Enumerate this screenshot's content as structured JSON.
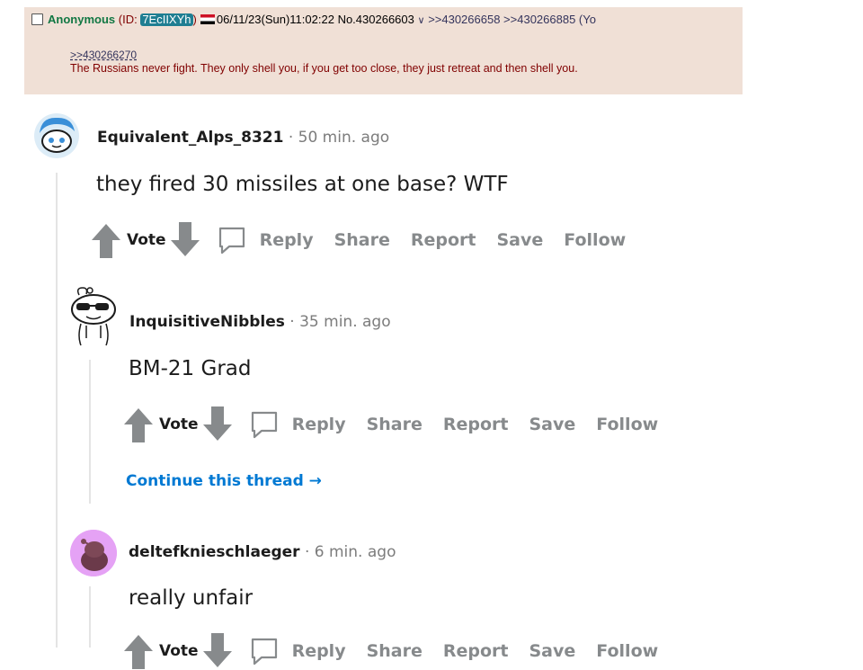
{
  "chan_post": {
    "name": "Anonymous",
    "id_prefix": "(ID: ",
    "id": "7EcIIXYh",
    "id_suffix": ")",
    "datetime": "06/11/23(Sun)11:02:22",
    "post_number": "No.430266603",
    "menu_glyph": "∨",
    "backlinks": ">>430266658 >>430266885 (Yo",
    "quote_link": ">>430266270",
    "text": "The Russians never fight. They only shell you, if you get too close, they just retreat and then shell you."
  },
  "comments": [
    {
      "username": "Equivalent_Alps_8321",
      "time": " · 50 min. ago",
      "text": "they fired 30 missiles at one base? WTF",
      "actions": {
        "vote": "Vote",
        "reply": "Reply",
        "share": "Share",
        "report": "Report",
        "save": "Save",
        "follow": "Follow"
      }
    },
    {
      "username": "InquisitiveNibbles",
      "time": " · 35 min. ago",
      "text": "BM-21 Grad",
      "actions": {
        "vote": "Vote",
        "reply": "Reply",
        "share": "Share",
        "report": "Report",
        "save": "Save",
        "follow": "Follow"
      },
      "continue_label": "Continue this thread →"
    },
    {
      "username": "deltefknieschlaeger",
      "time": " · 6 min. ago",
      "text": "really unfair",
      "actions": {
        "vote": "Vote",
        "reply": "Reply",
        "share": "Share",
        "report": "Report",
        "save": "Save",
        "follow": "Follow"
      }
    }
  ],
  "colors": {
    "chan_bg": "#f0e0d6",
    "chan_text": "#800000",
    "chan_name": "#117743",
    "chan_link": "#34345c",
    "vote_arrow": "#878a8c",
    "action_text": "#878a8c",
    "continue_link": "#0079d3",
    "thread_line": "#e4e4e4"
  }
}
